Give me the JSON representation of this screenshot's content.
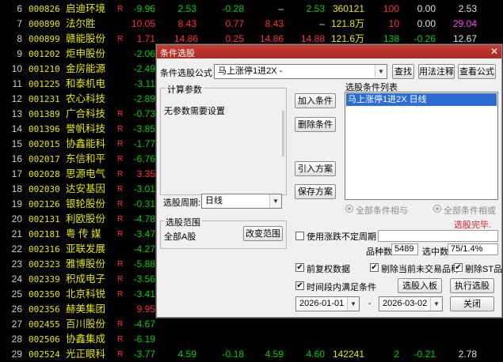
{
  "rows": [
    {
      "idx": "6",
      "code": "000826",
      "name": "启迪环境",
      "r": "R",
      "chg": "-9.96",
      "chg_color": "green",
      "c2": "2.53",
      "c2_color": "green",
      "c3": "-0.28",
      "c3_color": "green",
      "c4": "–",
      "c4_color": "white",
      "c5": "2.53",
      "c5_color": "green",
      "c6": "360121",
      "c6_color": "yellow",
      "c7": "100",
      "c7_color": "red",
      "c8": "0.00",
      "c8_color": "white",
      "c9": "2.53",
      "c9_color": "white"
    },
    {
      "idx": "7",
      "code": "000890",
      "name": "法尔胜",
      "r": "",
      "chg": "10.05",
      "chg_color": "red",
      "c2": "8.43",
      "c2_color": "red",
      "c3": "0.77",
      "c3_color": "red",
      "c4": "8.43",
      "c4_color": "red",
      "c5": "–",
      "c5_color": "white",
      "c6": "121.8万",
      "c6_color": "yellow",
      "c7": "10",
      "c7_color": "red",
      "c8": "0.00",
      "c8_color": "white",
      "c9": "29.04",
      "c9_color": "magenta"
    },
    {
      "idx": "8",
      "code": "000899",
      "name": "赣能股份",
      "r": "R",
      "chg": "1.71",
      "chg_color": "red",
      "c2": "14.86",
      "c2_color": "red",
      "c3": "0.25",
      "c3_color": "red",
      "c4": "14.86",
      "c4_color": "red",
      "c5": "14.88",
      "c5_color": "red",
      "c6": "121.6万",
      "c6_color": "yellow",
      "c7": "138",
      "c7_color": "green",
      "c8": "-0.26",
      "c8_color": "green",
      "c9": "12.67",
      "c9_color": "white"
    },
    {
      "idx": "9",
      "code": "001202",
      "name": "炬申股份",
      "r": "",
      "chg": "-2.06",
      "chg_color": "green"
    },
    {
      "idx": "10",
      "code": "001210",
      "name": "金房能源",
      "r": "",
      "chg": "-2.49",
      "chg_color": "green"
    },
    {
      "idx": "11",
      "code": "001225",
      "name": "和泰机电",
      "r": "",
      "chg": "-3.11",
      "chg_color": "green"
    },
    {
      "idx": "12",
      "code": "001231",
      "name": "农心科技",
      "r": "",
      "chg": "-2.89",
      "chg_color": "green"
    },
    {
      "idx": "13",
      "code": "001389",
      "name": "广合科技",
      "r": "R",
      "chg": "-0.73",
      "chg_color": "green"
    },
    {
      "idx": "14",
      "code": "001396",
      "name": "誉帆科技",
      "r": "R",
      "chg": "-3.85",
      "chg_color": "green"
    },
    {
      "idx": "15",
      "code": "002015",
      "name": "协鑫能科",
      "r": "R",
      "chg": "-1.77",
      "chg_color": "green"
    },
    {
      "idx": "16",
      "code": "002017",
      "name": "东信和平",
      "r": "R",
      "chg": "-6.76",
      "chg_color": "green"
    },
    {
      "idx": "17",
      "code": "002028",
      "name": "思源电气",
      "r": "R",
      "chg": "3.35",
      "chg_color": "red"
    },
    {
      "idx": "18",
      "code": "002030",
      "name": "达安基因",
      "r": "R",
      "chg": "-3.01",
      "chg_color": "green"
    },
    {
      "idx": "19",
      "code": "002126",
      "name": "银轮股份",
      "r": "R",
      "chg": "-0.31",
      "chg_color": "green"
    },
    {
      "idx": "20",
      "code": "002131",
      "name": "利欧股份",
      "r": "R",
      "chg": "-4.78",
      "chg_color": "green"
    },
    {
      "idx": "21",
      "code": "002181",
      "name": "粤 传 媒",
      "r": "R",
      "chg": "-3.47",
      "chg_color": "green"
    },
    {
      "idx": "22",
      "code": "002316",
      "name": "亚联发展",
      "r": "",
      "chg": "-4.27",
      "chg_color": "green"
    },
    {
      "idx": "23",
      "code": "002323",
      "name": "雅博股份",
      "r": "R",
      "chg": "-5.88",
      "chg_color": "green"
    },
    {
      "idx": "24",
      "code": "002339",
      "name": "积成电子",
      "r": "R",
      "chg": "-3.56",
      "chg_color": "green"
    },
    {
      "idx": "25",
      "code": "002350",
      "name": "北京科锐",
      "r": "R",
      "chg": "-3.41",
      "chg_color": "green"
    },
    {
      "idx": "26",
      "code": "002356",
      "name": "赫美集团",
      "r": "",
      "chg": "9.95",
      "chg_color": "red"
    },
    {
      "idx": "27",
      "code": "002455",
      "name": "百川股份",
      "r": "R",
      "chg": "-4.67",
      "chg_color": "green"
    },
    {
      "idx": "28",
      "code": "002506",
      "name": "协鑫集成",
      "r": "R",
      "chg": "-6.19",
      "chg_color": "green"
    },
    {
      "idx": "29",
      "code": "002524",
      "name": "光正眼科",
      "r": "R",
      "chg": "-3.77",
      "chg_color": "green",
      "c2": "4.59",
      "c2_color": "green",
      "c3": "-0.18",
      "c3_color": "green",
      "c4": "4.59",
      "c4_color": "green",
      "c5": "4.60",
      "c5_color": "green",
      "c6": "142241",
      "c6_color": "yellow",
      "c7": "2",
      "c7_color": "green",
      "c8": "-0.21",
      "c8_color": "green",
      "c9": "2.78",
      "c9_color": "white"
    }
  ],
  "dialog": {
    "title": "条件选股",
    "close_icon": "✕",
    "formula_label": "条件选股公式",
    "formula_value": "马上涨停1进2X  -",
    "btn_find": "查找",
    "btn_usage": "用法注释",
    "btn_view_formula": "查看公式",
    "calc_params_title": "计算参数",
    "no_params_text": "无参数需要设置",
    "btn_add": "加入条件",
    "btn_delete": "删除条件",
    "btn_import": "引入方案",
    "btn_save": "保存方案",
    "condition_list_title": "选股条件列表",
    "condition_items": [
      "马上涨停1进2X  日线"
    ],
    "period_label": "选股周期:",
    "period_value": "日线",
    "radio_and": "全部条件相与",
    "radio_or": "全部条件相或",
    "status_text": "选股完毕.",
    "range_title": "选股范围",
    "range_value": "全部A股",
    "btn_change_range": "改变范围",
    "chk_uncertain": "使用涨跌不定周期",
    "count_label": "品种数",
    "count_value": "5489",
    "selected_label": "选中数",
    "selected_value": "75/1.4%",
    "chk_prefq": "前复权数据",
    "chk_remove_untraded": "剔除当前未交易品种",
    "chk_remove_st": "剔除ST品种",
    "chk_time_range": "时间段内满足条件",
    "btn_add_block": "选股入板块",
    "btn_execute": "执行选股",
    "date_from": "2026-01-01",
    "date_sep": "-",
    "date_to": "2026-03-02",
    "btn_close": "关闭"
  }
}
